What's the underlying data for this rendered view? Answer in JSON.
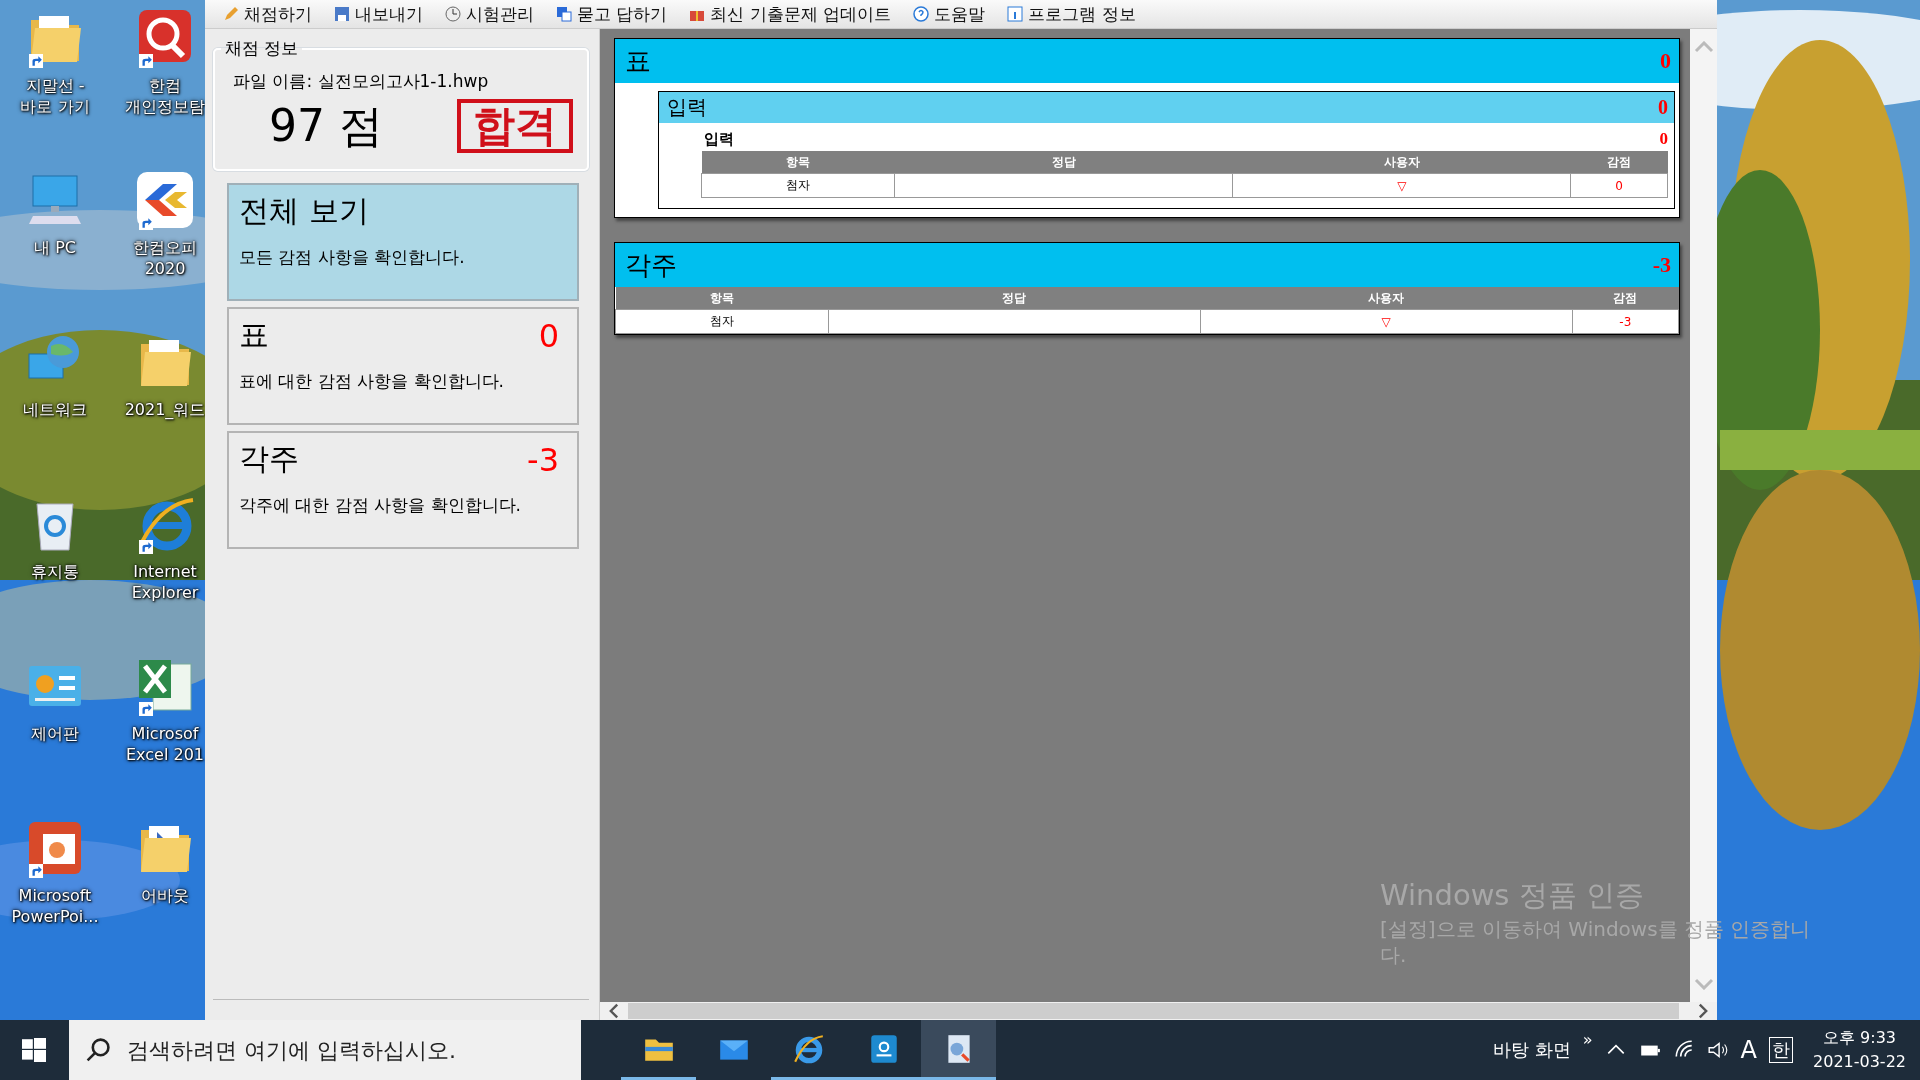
{
  "desktop_icons": [
    {
      "kind": "folder",
      "lines": [
        "지말선 -",
        "바로 가기"
      ],
      "shortcut": true
    },
    {
      "kind": "privacy-app",
      "lines": [
        "한컴",
        "개인정보탐"
      ],
      "shortcut": true
    },
    {
      "kind": "computer",
      "lines": [
        "내 PC"
      ],
      "shortcut": false
    },
    {
      "kind": "office-app",
      "lines": [
        "한컴오피",
        "2020"
      ],
      "shortcut": true
    },
    {
      "kind": "network",
      "lines": [
        "네트워크"
      ],
      "shortcut": false
    },
    {
      "kind": "doc-folder",
      "lines": [
        "2021_워드"
      ],
      "shortcut": false
    },
    {
      "kind": "recycle-bin",
      "lines": [
        "휴지통"
      ],
      "shortcut": false
    },
    {
      "kind": "browser",
      "lines": [
        "Internet",
        "Explorer"
      ],
      "shortcut": true
    },
    {
      "kind": "control-panel",
      "lines": [
        "제어판"
      ],
      "shortcut": false
    },
    {
      "kind": "spreadsheet",
      "lines": [
        "Microsof",
        "Excel 201"
      ],
      "shortcut": true
    },
    {
      "kind": "presentation",
      "lines": [
        "Microsoft",
        "PowerPoi..."
      ],
      "shortcut": true
    },
    {
      "kind": "video-folder",
      "lines": [
        "어바웃"
      ],
      "shortcut": false
    }
  ],
  "toolbar": [
    {
      "kind": "pencil",
      "label": "채점하기"
    },
    {
      "kind": "save",
      "label": "내보내기"
    },
    {
      "kind": "clock",
      "label": "시험관리"
    },
    {
      "kind": "translate",
      "label": "묻고 답하기"
    },
    {
      "kind": "gift",
      "label": "최신 기출문제 업데이트"
    },
    {
      "kind": "help",
      "label": "도움말"
    },
    {
      "kind": "info",
      "label": "프로그램 정보"
    }
  ],
  "scoring_info": {
    "title": "채점 정보",
    "file_name": "파일 이름: 실전모의고사1-1.hwp",
    "score": "97 점",
    "result_stamp": "합격"
  },
  "categories": [
    {
      "title": "전체 보기",
      "description": "모든 감점 사항을 확인합니다.",
      "selected": true
    },
    {
      "title": "표",
      "deduction": "0",
      "description": "표에 대한 감점 사항을 확인합니다.",
      "selected": false
    },
    {
      "title": "각주",
      "deduction": "-3",
      "description": "각주에 대한 감점 사항을 확인합니다.",
      "selected": false
    }
  ],
  "sections": [
    {
      "title": "표",
      "deduction": "0",
      "subsections": [
        {
          "title": "입력",
          "deduction": "0",
          "items": [
            {
              "title": "입력",
              "deduction": "0",
              "columns": [
                "항목",
                "정답",
                "사용자",
                "감점"
              ],
              "rows": [
                {
                  "item": "첨자",
                  "user": "▽",
                  "deduction": "0"
                }
              ]
            }
          ]
        }
      ]
    },
    {
      "title": "각주",
      "deduction": "-3",
      "columns": [
        "항목",
        "정답",
        "사용자",
        "감점"
      ],
      "rows": [
        {
          "item": "첨자",
          "user": "▽",
          "deduction": "-3"
        }
      ]
    }
  ],
  "activation_notice": {
    "title": "Windows 정품 인증",
    "message": "[설정]으로 이동하여 Windows를 정품 인증합니다."
  },
  "taskbar": {
    "search_placeholder": "검색하려면 여기에 입력하십시오.",
    "apps": [
      {
        "kind": "file-explorer",
        "running": true,
        "selected": false
      },
      {
        "kind": "mail",
        "running": false,
        "selected": false
      },
      {
        "kind": "browser",
        "running": true,
        "selected": false
      },
      {
        "kind": "hwp",
        "running": true,
        "selected": false
      },
      {
        "kind": "grader",
        "running": true,
        "selected": true
      }
    ],
    "desktop_label": "바탕 화면",
    "overflow": "»",
    "ime_mode": "A",
    "ime_lang": "한",
    "time": "오후 9:33",
    "date": "2021-03-22"
  }
}
